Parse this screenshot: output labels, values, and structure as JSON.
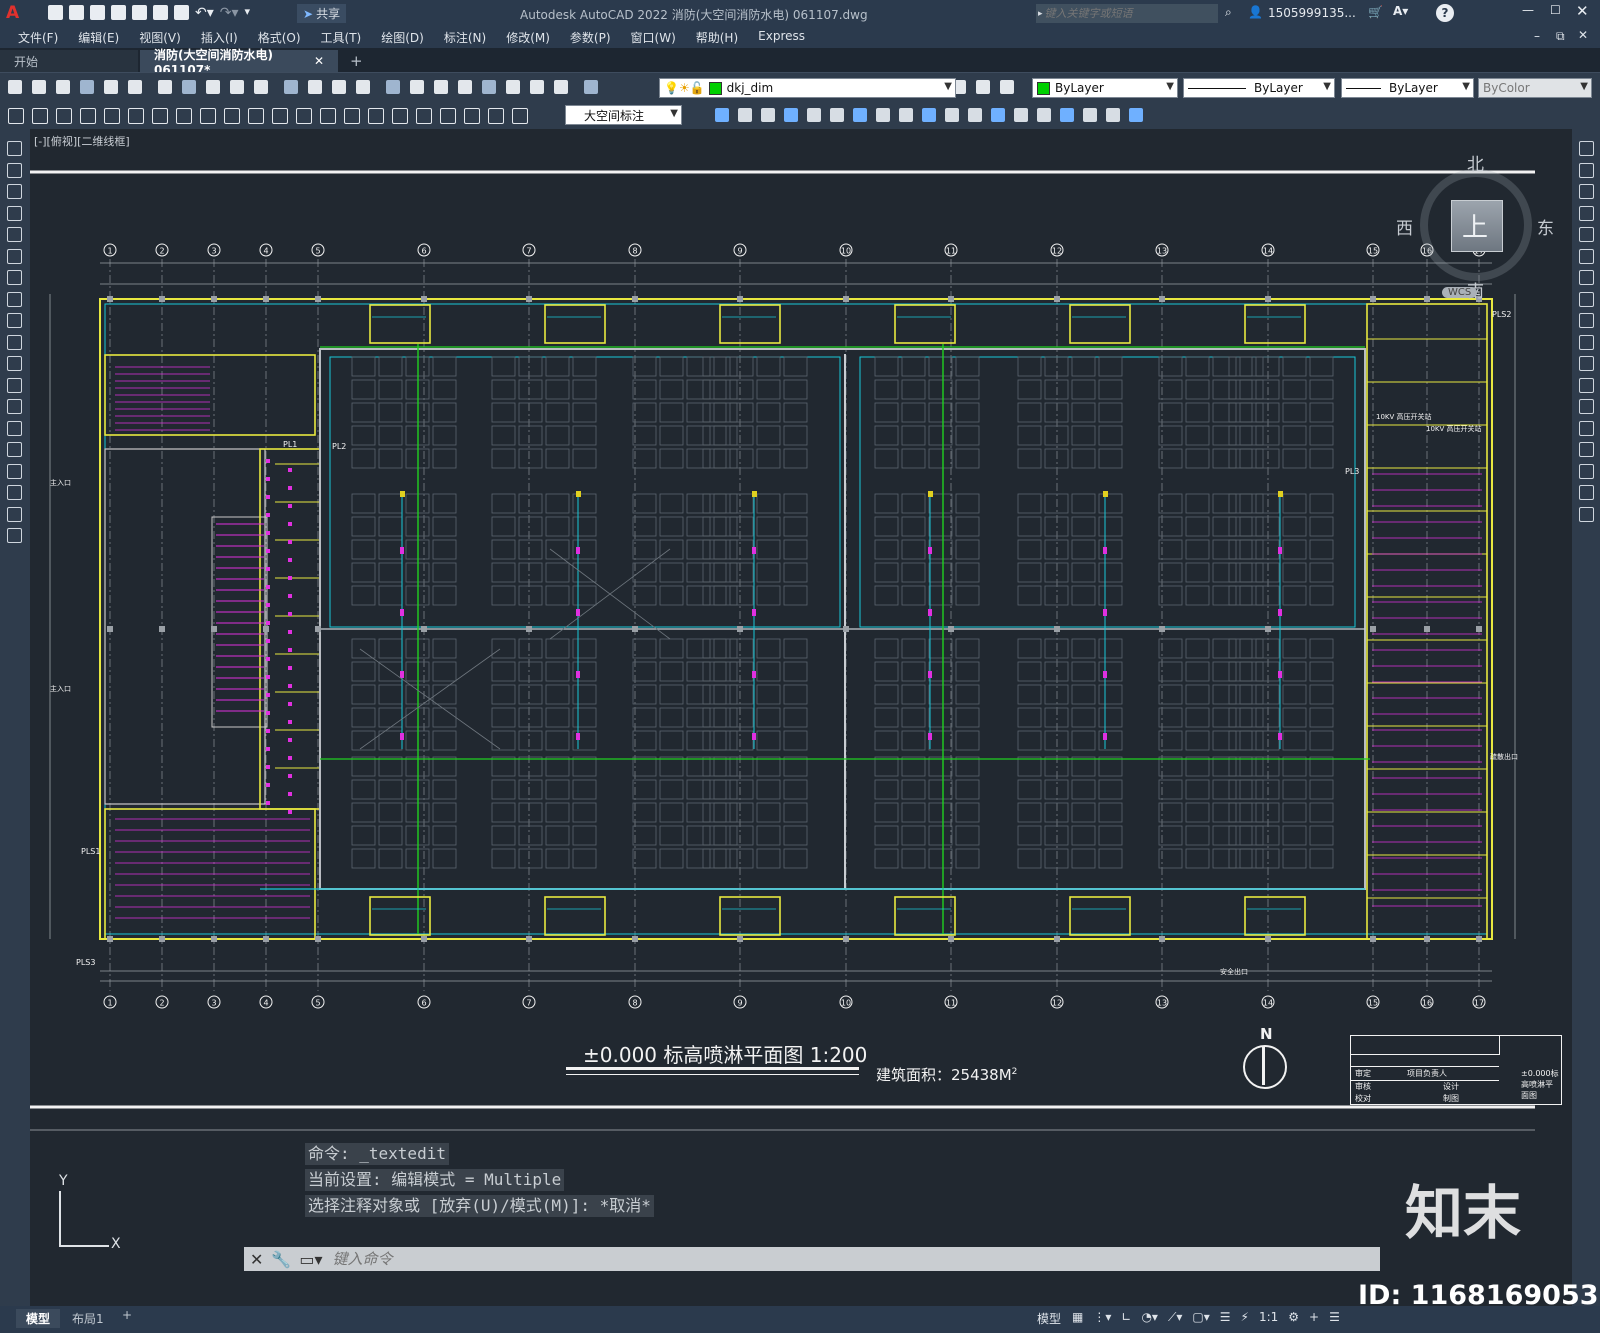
{
  "app": {
    "title": "Autodesk AutoCAD 2022    消防(大空间消防水电) 061107.dwg",
    "share_label": "共享",
    "search_placeholder": "键入关键字或短语",
    "user_label": "1505999135...",
    "window_controls": [
      "minimize-icon",
      "maximize-icon",
      "close-icon"
    ]
  },
  "menu": [
    "文件(F)",
    "编辑(E)",
    "视图(V)",
    "插入(I)",
    "格式(O)",
    "工具(T)",
    "绘图(D)",
    "标注(N)",
    "修改(M)",
    "参数(P)",
    "窗口(W)",
    "帮助(H)",
    "Express"
  ],
  "tabs": [
    {
      "label": "开始",
      "active": false
    },
    {
      "label": "消防(大空间消防水电) 061107*",
      "active": true
    }
  ],
  "toolbar1": {
    "layer_value": "dkj_dim",
    "color_value": "ByLayer",
    "linetype_value": "ByLayer",
    "lineweight_value": "ByLayer",
    "plotstyle_value": "ByColor"
  },
  "toolbar2": {
    "dimstyle_value": "大空间标注"
  },
  "viewport": {
    "label": "[-][俯视][二维线框]",
    "viewcube": {
      "north": "北",
      "south": "南",
      "east": "东",
      "west": "西",
      "top": "上",
      "wcs": "WCS"
    }
  },
  "drawing": {
    "title": "±0.000 标高喷淋平面图 1:200",
    "area_label": "建筑面积：25438M",
    "area_sup": "2",
    "north_label": "N",
    "grid_numbers": [
      "1",
      "2",
      "3",
      "4",
      "5",
      "6",
      "7",
      "8",
      "9",
      "10",
      "11",
      "12",
      "13",
      "14",
      "15",
      "16",
      "17"
    ],
    "riser_labels": [
      "PL1",
      "PL2",
      "PL3",
      "PLS1",
      "PLS2",
      "PLS3"
    ],
    "room_labels": [
      "10KV 高压开关站",
      "10KV 高压开关站",
      "主入口",
      "主入口",
      "疏散出口",
      "安全出口"
    ],
    "title_block_rows": [
      "审定",
      "审核",
      "校对"
    ],
    "title_block_cols": [
      "项目负责人",
      "设计",
      "制图"
    ],
    "title_block_name": "±0.000标高喷淋平面图"
  },
  "command": {
    "history": [
      "命令: _textedit",
      "当前设置: 编辑模式 = Multiple",
      "选择注释对象或 [放弃(U)/模式(M)]: *取消*"
    ],
    "input_placeholder": "键入命令"
  },
  "status": {
    "layout_tabs": [
      "模型",
      "布局1"
    ],
    "model_label": "模型",
    "scale_label": "1:1"
  },
  "watermark": {
    "brand": "知末",
    "id_text": "ID: 1168169053"
  },
  "colors": {
    "background": "#212830",
    "wall": "#e8e840",
    "pipe_cyan": "#19c8d8",
    "pipe_green": "#20d020",
    "sprinkler_magenta": "#e030e0",
    "grid": "#9aa0a6",
    "text_white": "#f2f2f2"
  }
}
